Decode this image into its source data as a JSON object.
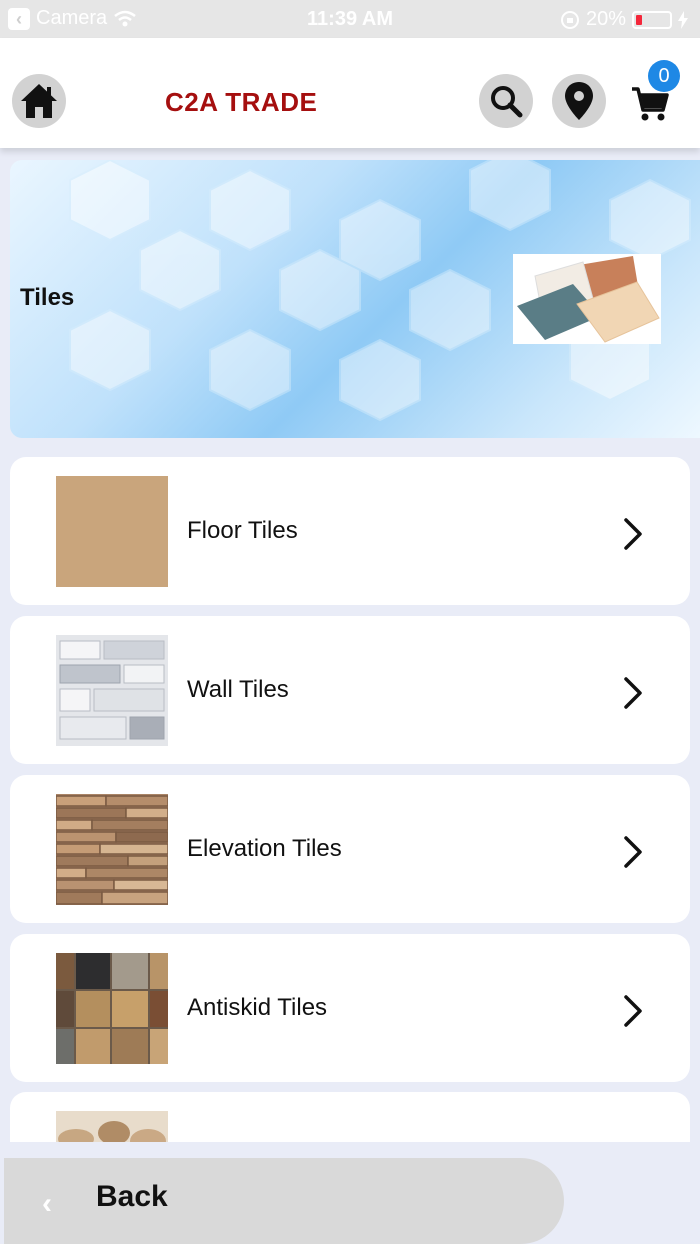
{
  "status_bar": {
    "carrier": "Camera",
    "time": "11:39 AM",
    "battery": "20%",
    "battery_level": 0.2,
    "battery_color": "#f4273a"
  },
  "header": {
    "brand": "C2A TRADE",
    "brand_color": "#a50f0f",
    "cart_count": "0",
    "icons": [
      "home-icon",
      "search-icon",
      "location-pin-icon",
      "cart-icon"
    ]
  },
  "banner": {
    "title": "Tiles"
  },
  "categories": [
    {
      "label": "Floor Tiles"
    },
    {
      "label": "Wall Tiles"
    },
    {
      "label": "Elevation Tiles"
    },
    {
      "label": "Antiskid Tiles"
    },
    {
      "label": ""
    }
  ],
  "footer": {
    "back_label": "Back"
  }
}
